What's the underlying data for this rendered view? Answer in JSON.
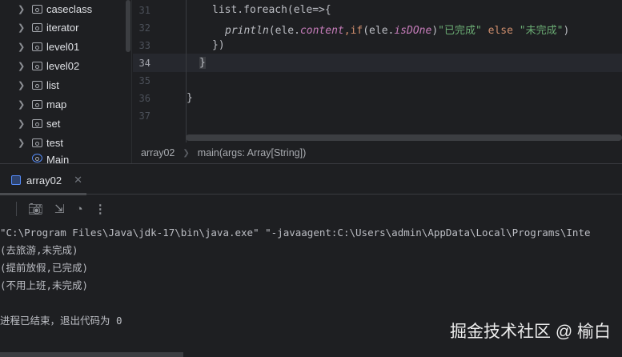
{
  "sidebar": {
    "items": [
      "caseclass",
      "iterator",
      "level01",
      "level02",
      "list",
      "map",
      "set",
      "test"
    ],
    "partial_item": "Main"
  },
  "editor": {
    "lines": [
      {
        "n": "31"
      },
      {
        "n": "32"
      },
      {
        "n": "33"
      },
      {
        "n": "34"
      },
      {
        "n": "35"
      },
      {
        "n": "36"
      },
      {
        "n": "37"
      }
    ],
    "code": {
      "l31": "list.foreach(ele=>{",
      "l32_fn": "println",
      "l32_a": "(ele.",
      "l32_field": "content",
      "l32_b": ",",
      "l32_if": "if",
      "l32_c": "(ele.",
      "l32_field2": "isDOne",
      "l32_d": ")",
      "l32_s1": "\"已完成\"",
      "l32_else": " else ",
      "l32_s2": "\"未完成\"",
      "l32_e": ")",
      "l33": "})",
      "l34": "}",
      "l36": "}"
    }
  },
  "breadcrumb": {
    "file": "array02",
    "method": "main(args: Array[String])"
  },
  "run_tab": {
    "label": "array02"
  },
  "console": {
    "lines": [
      "\"C:\\Program Files\\Java\\jdk-17\\bin\\java.exe\" \"-javaagent:C:\\Users\\admin\\AppData\\Local\\Programs\\Inte",
      "(去旅游,未完成)",
      "(提前放假,已完成)",
      "(不用上班,未完成)",
      "",
      "进程已结束，退出代码为 0"
    ]
  },
  "watermark": "掘金技术社区 @ 榆白"
}
